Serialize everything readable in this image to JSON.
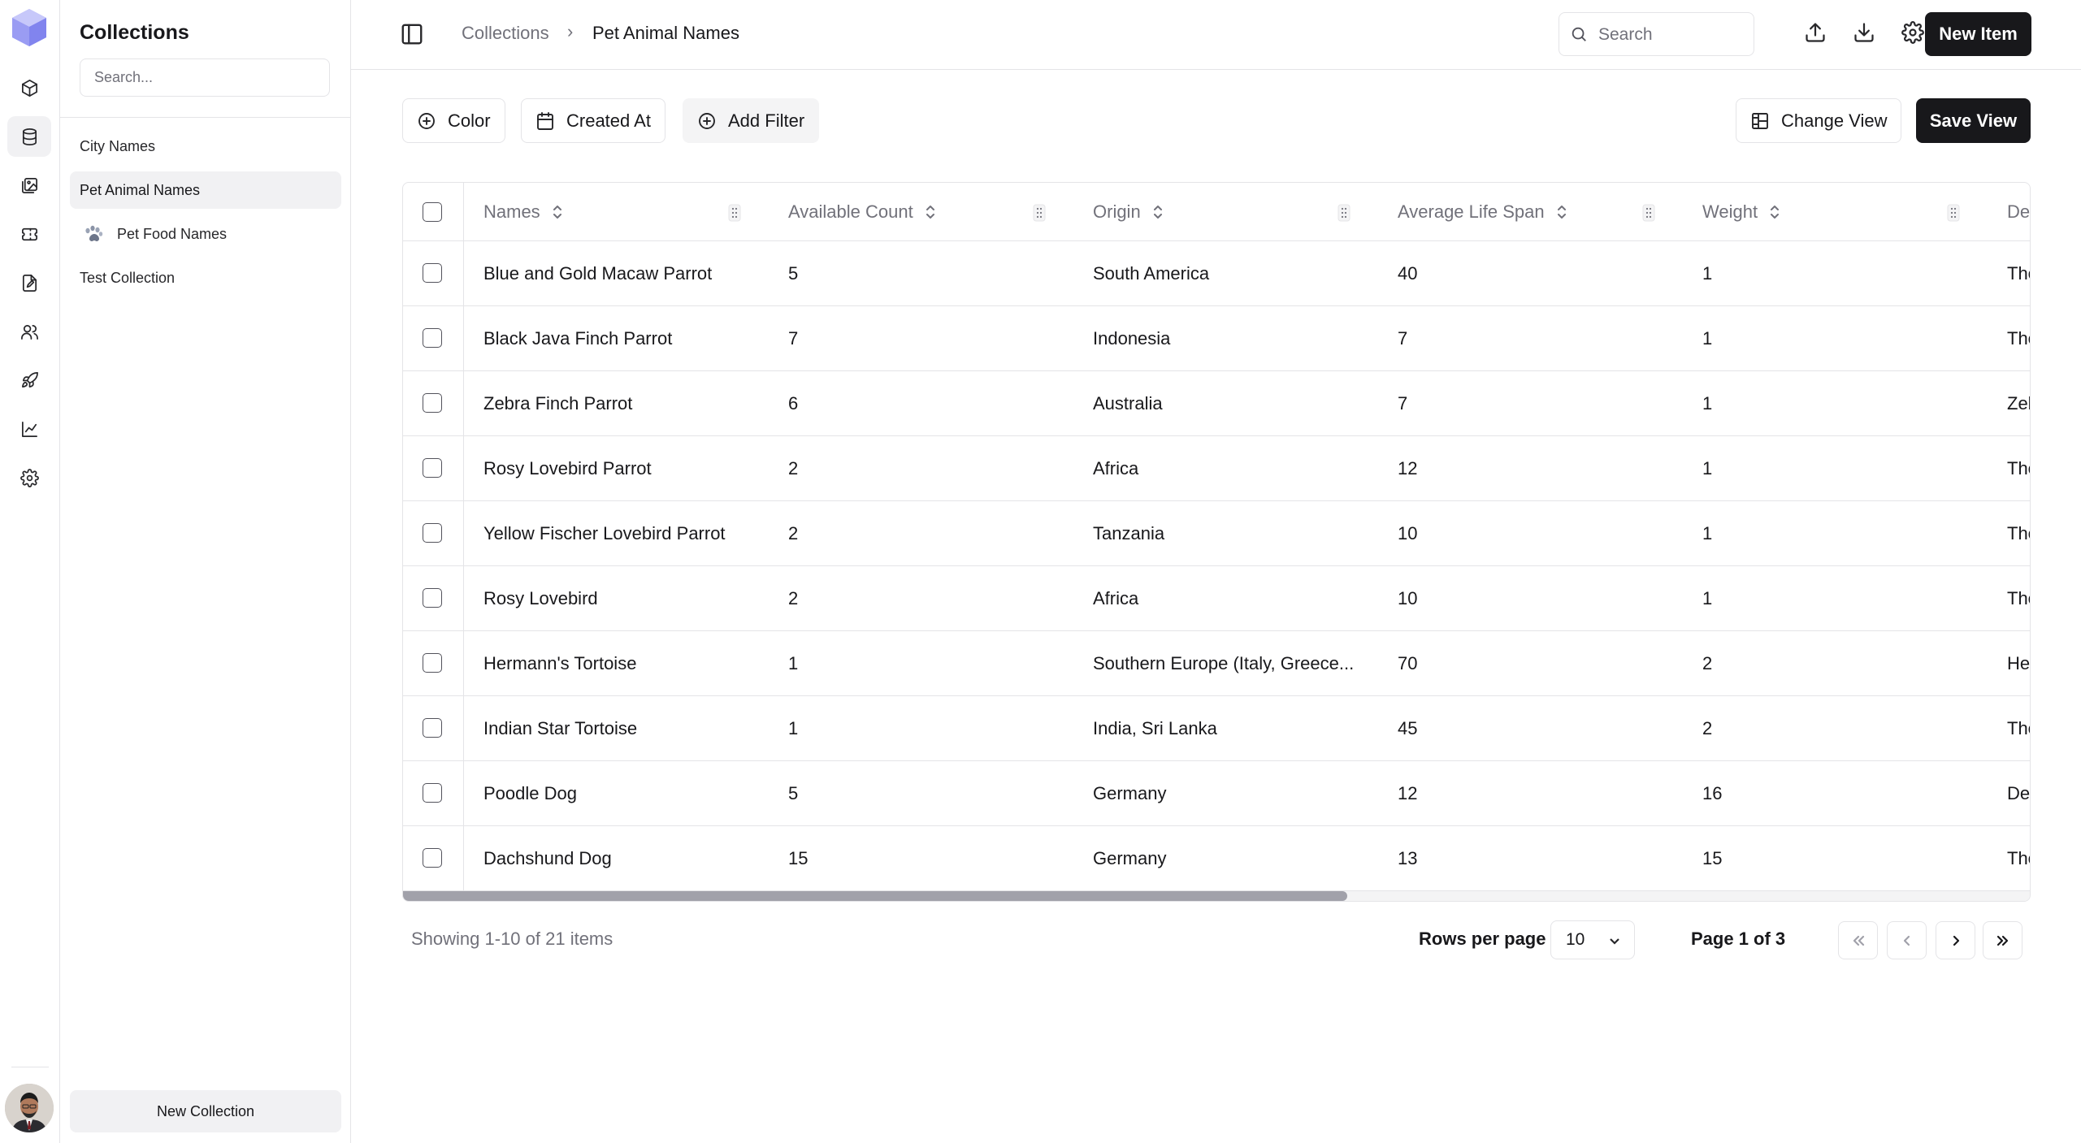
{
  "rail": {
    "items": [
      {
        "icon": "box-icon"
      },
      {
        "icon": "database-icon",
        "active": true
      },
      {
        "icon": "images-icon"
      },
      {
        "icon": "ticket-icon"
      },
      {
        "icon": "file-edit-icon"
      },
      {
        "icon": "users-icon"
      },
      {
        "icon": "rocket-icon"
      },
      {
        "icon": "chart-line-icon"
      },
      {
        "icon": "gear-icon"
      }
    ]
  },
  "panel": {
    "title": "Collections",
    "search_placeholder": "Search...",
    "items": [
      {
        "label": "City Names"
      },
      {
        "label": "Pet Animal Names",
        "active": true
      },
      {
        "label": "Pet Food Names",
        "icon": "paw-icon"
      },
      {
        "label": "Test Collection"
      }
    ],
    "new_collection": "New Collection"
  },
  "header": {
    "breadcrumb": [
      "Collections",
      "Pet Animal Names"
    ],
    "breadcrumb_separator": "›",
    "search_placeholder": "Search",
    "new_item": "New Item"
  },
  "filters": {
    "color": "Color",
    "created_at": "Created At",
    "add_filter": "Add Filter",
    "change_view": "Change View",
    "save_view": "Save View"
  },
  "table": {
    "columns": [
      "Names",
      "Available Count",
      "Origin",
      "Average Life Span",
      "Weight",
      "De"
    ],
    "rows": [
      [
        "Blue and Gold Macaw Parrot",
        "5",
        "South America",
        "40",
        "1",
        "The"
      ],
      [
        "Black Java Finch Parrot",
        "7",
        "Indonesia",
        "7",
        "1",
        "The"
      ],
      [
        "Zebra Finch Parrot",
        "6",
        "Australia",
        "7",
        "1",
        "Zeb"
      ],
      [
        "Rosy Lovebird Parrot",
        "2",
        "Africa",
        "12",
        "1",
        "The"
      ],
      [
        "Yellow Fischer Lovebird Parrot",
        "2",
        "Tanzania",
        "10",
        "1",
        "The"
      ],
      [
        "Rosy Lovebird",
        "2",
        "Africa",
        "10",
        "1",
        "The"
      ],
      [
        "Hermann's Tortoise",
        "1",
        "Southern Europe (Italy, Greece...",
        "70",
        "2",
        "He"
      ],
      [
        "Indian Star Tortoise",
        "1",
        "India, Sri Lanka",
        "45",
        "2",
        "The"
      ],
      [
        "Poodle Dog",
        "5",
        "Germany",
        "12",
        "16",
        "De"
      ],
      [
        "Dachshund Dog",
        "15",
        "Germany",
        "13",
        "15",
        "The"
      ]
    ],
    "horizontal_scroll_fraction": 0.58
  },
  "pagination": {
    "showing": "Showing 1-10 of 21 items",
    "rows_per_page_label": "Rows per page",
    "rows_per_page_value": "10",
    "page_info": "Page 1 of 3"
  }
}
